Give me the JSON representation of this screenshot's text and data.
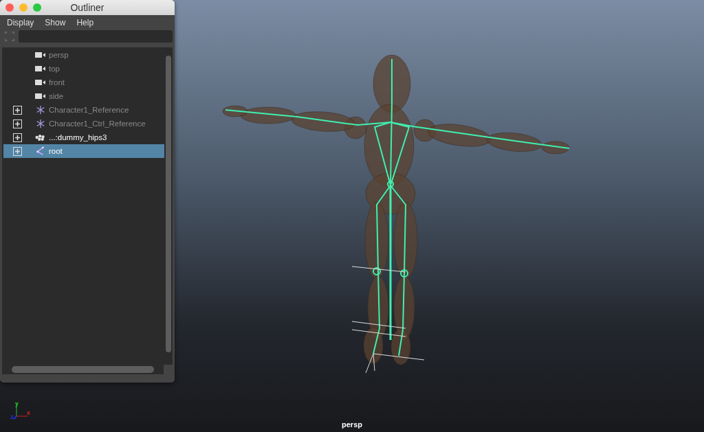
{
  "outliner": {
    "title": "Outliner",
    "menu": [
      "Display",
      "Show",
      "Help"
    ],
    "items": [
      {
        "label": "persp",
        "kind": "camera",
        "expandable": false,
        "dimmed": true,
        "selected": false
      },
      {
        "label": "top",
        "kind": "camera",
        "expandable": false,
        "dimmed": true,
        "selected": false
      },
      {
        "label": "front",
        "kind": "camera",
        "expandable": false,
        "dimmed": true,
        "selected": false
      },
      {
        "label": "side",
        "kind": "camera",
        "expandable": false,
        "dimmed": true,
        "selected": false
      },
      {
        "label": "Character1_Reference",
        "kind": "reference",
        "expandable": true,
        "dimmed": true,
        "selected": false
      },
      {
        "label": "Character1_Ctrl_Reference",
        "kind": "reference",
        "expandable": true,
        "dimmed": true,
        "selected": false
      },
      {
        "label": "...:dummy_hips3",
        "kind": "mesh",
        "expandable": true,
        "dimmed": false,
        "selected": false
      },
      {
        "label": "root",
        "kind": "joint",
        "expandable": true,
        "dimmed": false,
        "selected": true
      }
    ]
  },
  "viewport": {
    "camera_label": "persp",
    "axes": [
      {
        "label": "y",
        "kind": "y"
      },
      {
        "label": "x",
        "kind": "x"
      },
      {
        "label": "z",
        "kind": "z"
      }
    ]
  }
}
